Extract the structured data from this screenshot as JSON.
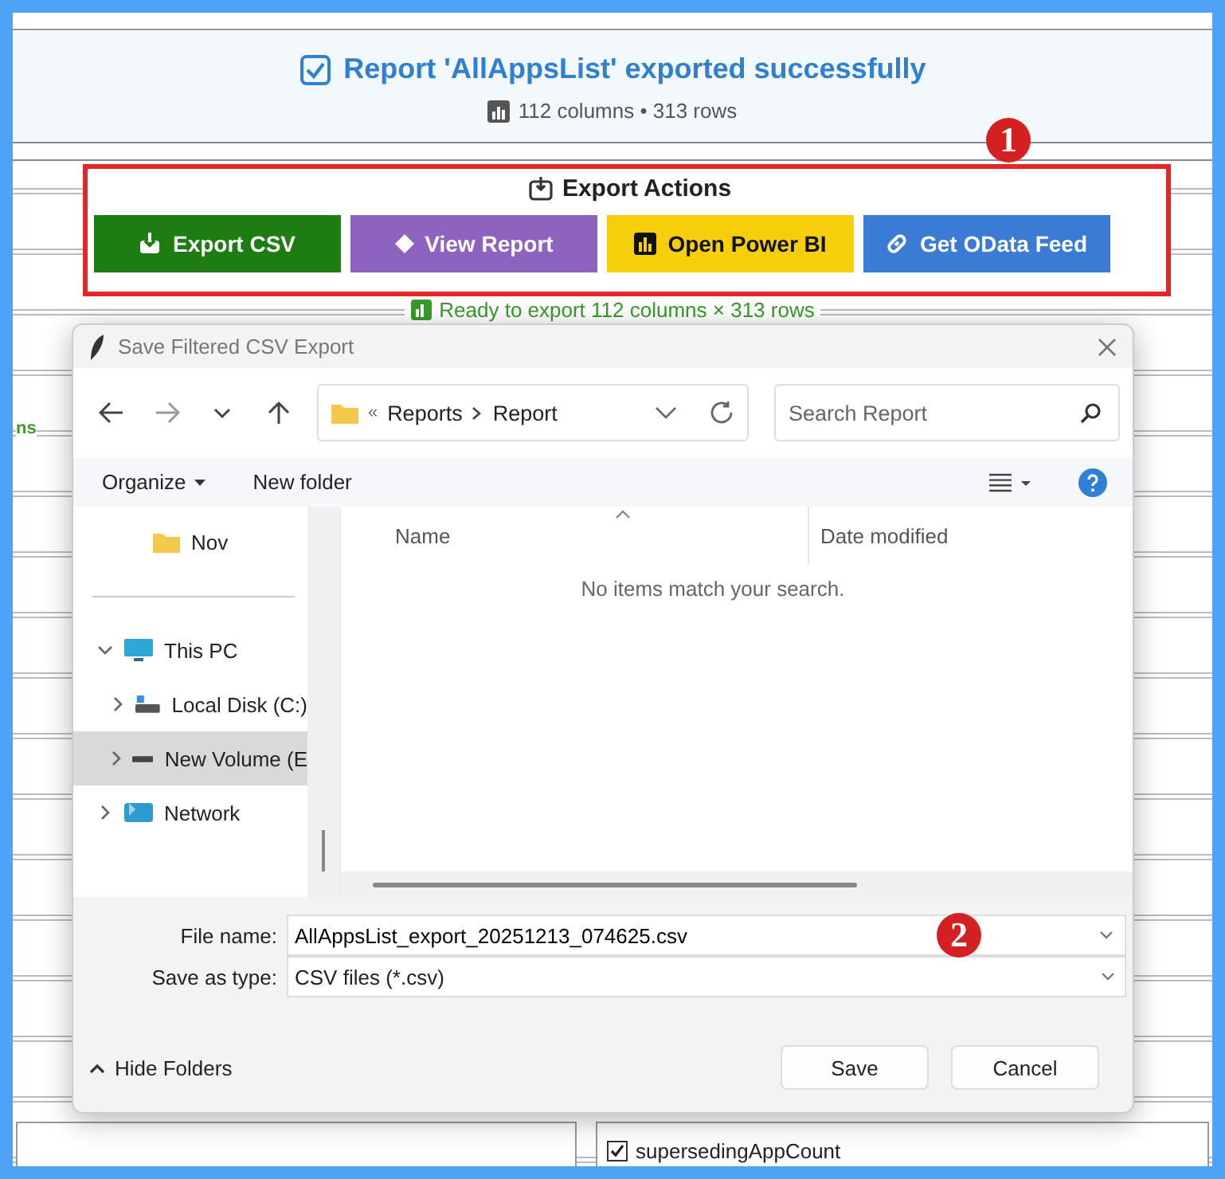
{
  "header": {
    "title": "Report 'AllAppsList' exported successfully",
    "summary": "112 columns • 313 rows"
  },
  "export_actions": {
    "title": "Export Actions",
    "buttons": [
      {
        "label": "Export CSV",
        "kind": "csv"
      },
      {
        "label": "View Report",
        "kind": "view"
      },
      {
        "label": "Open Power BI",
        "kind": "powerbi"
      },
      {
        "label": "Get OData Feed",
        "kind": "odata"
      }
    ],
    "status": "Ready to export 112 columns × 313 rows"
  },
  "background": {
    "side_text": "ns",
    "option": {
      "label": "supersedingAppCount",
      "checked": true
    }
  },
  "dialog": {
    "title": "Save Filtered CSV Export",
    "overflow": "«",
    "breadcrumb": [
      "Reports",
      "Report"
    ],
    "search": {
      "placeholder": "Search Report"
    },
    "toolbar": [
      "Organize",
      "New folder"
    ],
    "nav": [
      {
        "label": "Nov",
        "kind": "folder",
        "selected": false
      },
      {
        "label": "This PC",
        "kind": "pc",
        "selected": false,
        "expanded": true,
        "children": [
          {
            "label": "Local Disk (C:)",
            "kind": "disk",
            "selected": false,
            "expanded": false
          },
          {
            "label": "New Volume (E",
            "kind": "volume",
            "selected": true,
            "expanded": false
          }
        ]
      },
      {
        "label": "Network",
        "kind": "network",
        "selected": false,
        "expanded": false
      }
    ],
    "columns": [
      "Name",
      "Date modified"
    ],
    "empty_message": "No items match your search.",
    "file_name_label": "File name:",
    "file_name": "AllAppsList_export_20251213_074625.csv",
    "type_label": "Save as type:",
    "type": "CSV files (*.csv)",
    "hide_folders": "Hide Folders",
    "buttons": [
      "Save",
      "Cancel"
    ]
  },
  "annotations": [
    "1",
    "2"
  ]
}
